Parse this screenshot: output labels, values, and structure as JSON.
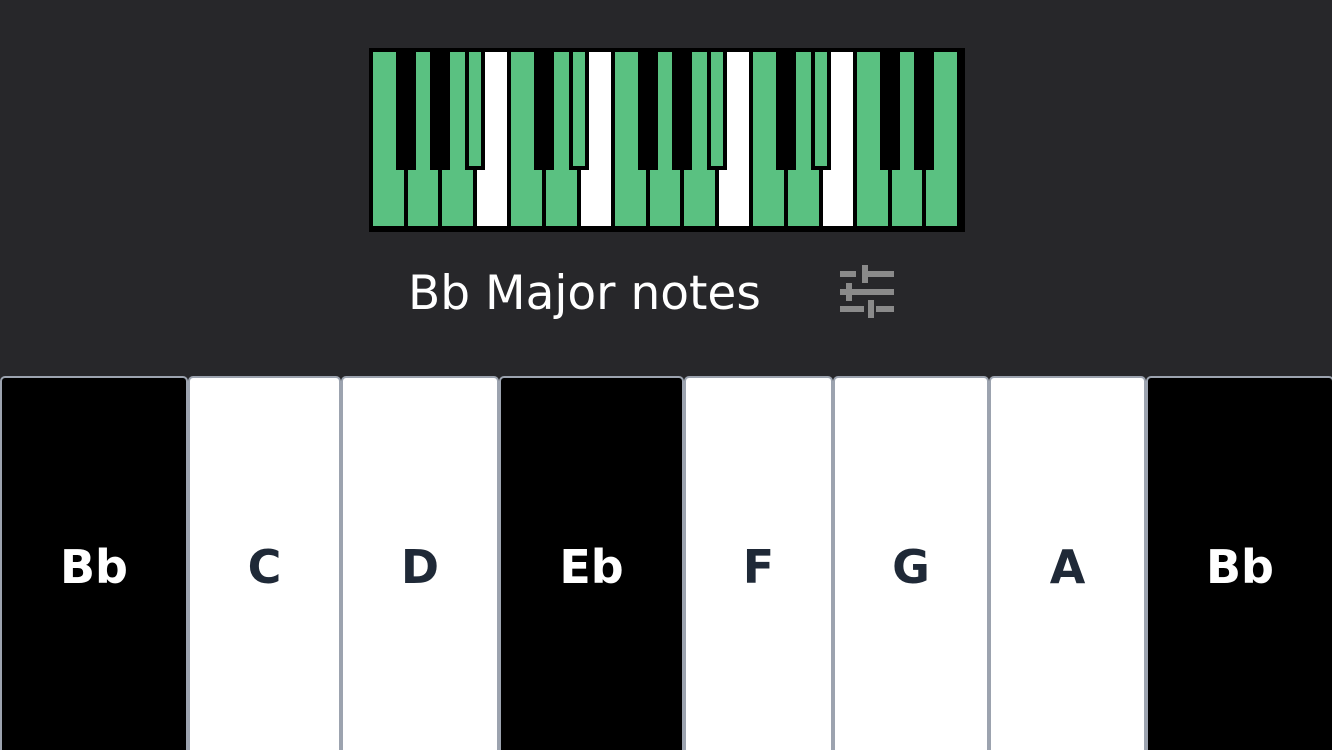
{
  "title": "Bb Major notes",
  "settings": {
    "icon": "sliders-icon"
  },
  "colors": {
    "background": "#27272a",
    "highlight": "#5ac181",
    "white_key": "#ffffff",
    "black_key": "#000000",
    "key_border": "#9ca3af",
    "white_label": "#1f2937",
    "black_label": "#ffffff",
    "icon": "#8a8a8a"
  },
  "mini_keyboard": {
    "white_keys": [
      {
        "note": "C",
        "highlighted": true
      },
      {
        "note": "D",
        "highlighted": true
      },
      {
        "note": "E",
        "highlighted": true
      },
      {
        "note": "F",
        "highlighted": false
      },
      {
        "note": "G",
        "highlighted": true
      },
      {
        "note": "A",
        "highlighted": true
      },
      {
        "note": "B",
        "highlighted": false
      },
      {
        "note": "C",
        "highlighted": true
      },
      {
        "note": "D",
        "highlighted": true
      },
      {
        "note": "E",
        "highlighted": true
      },
      {
        "note": "F",
        "highlighted": false
      },
      {
        "note": "G",
        "highlighted": true
      },
      {
        "note": "A",
        "highlighted": true
      },
      {
        "note": "B",
        "highlighted": false
      },
      {
        "note": "C",
        "highlighted": true
      },
      {
        "note": "D",
        "highlighted": true
      },
      {
        "note": "E",
        "highlighted": true
      }
    ],
    "black_keys": [
      {
        "after_white": 0,
        "highlighted": false
      },
      {
        "after_white": 1,
        "highlighted": false
      },
      {
        "after_white": 2,
        "highlighted": true
      },
      {
        "after_white": 4,
        "highlighted": false
      },
      {
        "after_white": 5,
        "highlighted": true
      },
      {
        "after_white": 7,
        "highlighted": false
      },
      {
        "after_white": 8,
        "highlighted": false
      },
      {
        "after_white": 9,
        "highlighted": true
      },
      {
        "after_white": 11,
        "highlighted": false
      },
      {
        "after_white": 12,
        "highlighted": true
      },
      {
        "after_white": 14,
        "highlighted": false
      },
      {
        "after_white": 15,
        "highlighted": false
      }
    ]
  },
  "notes": [
    {
      "label": "Bb",
      "color": "black"
    },
    {
      "label": "C",
      "color": "white"
    },
    {
      "label": "D",
      "color": "white"
    },
    {
      "label": "Eb",
      "color": "black"
    },
    {
      "label": "F",
      "color": "white"
    },
    {
      "label": "G",
      "color": "white"
    },
    {
      "label": "A",
      "color": "white"
    },
    {
      "label": "Bb",
      "color": "black"
    }
  ]
}
